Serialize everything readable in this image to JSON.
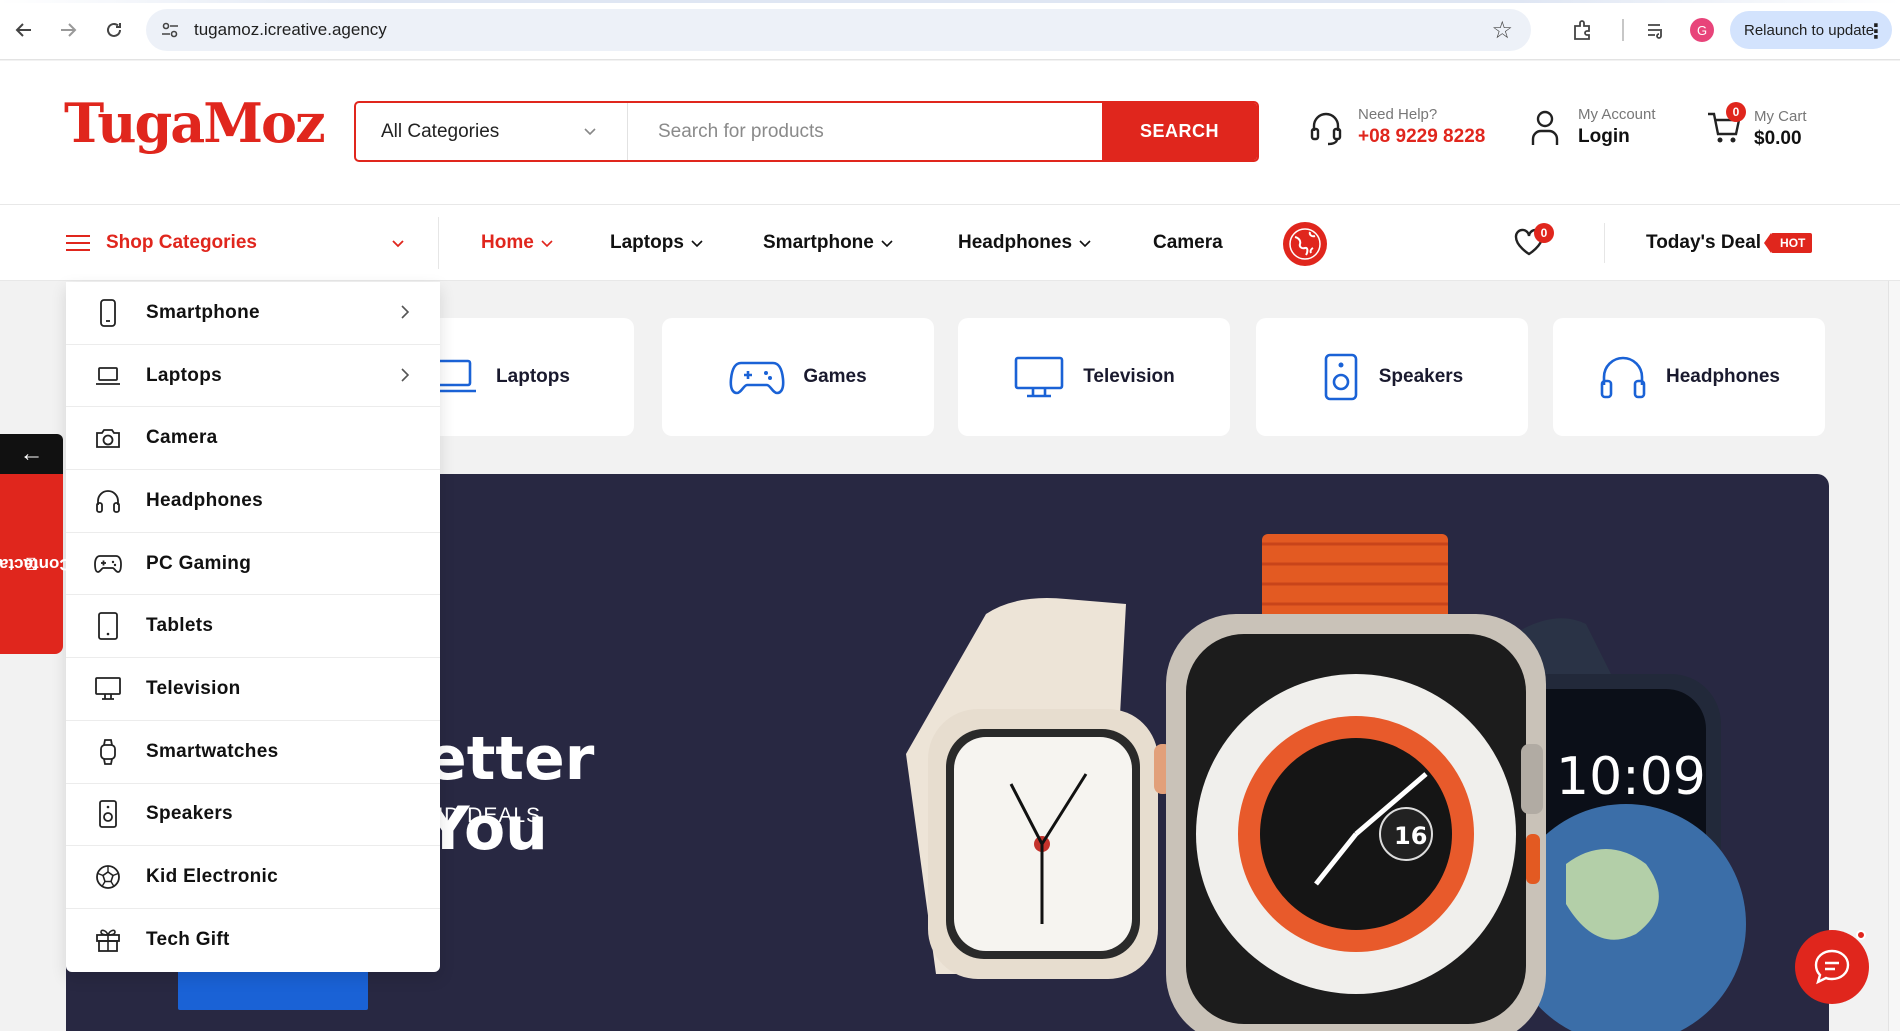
{
  "browser": {
    "url": "tugamoz.icreative.agency",
    "profile_initial": "G",
    "relaunch_label": "Relaunch to update"
  },
  "header": {
    "logo_part1": "Tuga",
    "logo_part2": "Moz",
    "category_select": "All Categories",
    "search_placeholder": "Search for products",
    "search_button": "SEARCH",
    "help_label": "Need Help?",
    "help_phone": "+08 9229 8228",
    "account_label": "My Account",
    "account_action": "Login",
    "cart_label": "My Cart",
    "cart_total": "$0.00",
    "cart_count": "0"
  },
  "nav": {
    "shop_categories": "Shop Categories",
    "items": [
      {
        "label": "Home",
        "has_dropdown": true,
        "active": true
      },
      {
        "label": "Laptops",
        "has_dropdown": true
      },
      {
        "label": "Smartphone",
        "has_dropdown": true
      },
      {
        "label": "Headphones",
        "has_dropdown": true
      },
      {
        "label": "Camera",
        "has_dropdown": false
      }
    ],
    "wishlist_count": "0",
    "todays_deal": "Today's Deal",
    "hot_badge": "HOT"
  },
  "dropdown": {
    "items": [
      {
        "label": "Smartphone",
        "icon": "smartphone-icon",
        "has_submenu": true
      },
      {
        "label": "Laptops",
        "icon": "laptop-icon",
        "has_submenu": true
      },
      {
        "label": "Camera",
        "icon": "camera-icon",
        "has_submenu": false
      },
      {
        "label": "Headphones",
        "icon": "headphones-icon",
        "has_submenu": false
      },
      {
        "label": "PC Gaming",
        "icon": "gamepad-icon",
        "has_submenu": false
      },
      {
        "label": "Tablets",
        "icon": "tablet-icon",
        "has_submenu": false
      },
      {
        "label": "Television",
        "icon": "television-icon",
        "has_submenu": false
      },
      {
        "label": "Smartwatches",
        "icon": "smartwatch-icon",
        "has_submenu": false
      },
      {
        "label": "Speakers",
        "icon": "speaker-icon",
        "has_submenu": false
      },
      {
        "label": "Kid Electronic",
        "icon": "ball-icon",
        "has_submenu": false
      },
      {
        "label": "Tech Gift",
        "icon": "gift-icon",
        "has_submenu": false
      }
    ]
  },
  "category_cards": [
    {
      "label": "Laptops",
      "icon": "laptop-icon"
    },
    {
      "label": "Games",
      "icon": "gamepad-icon"
    },
    {
      "label": "Television",
      "icon": "television-icon"
    },
    {
      "label": "Speakers",
      "icon": "speaker-icon"
    },
    {
      "label": "Headphones",
      "icon": "headphones-icon"
    }
  ],
  "hero": {
    "title_visible": "etter You",
    "subtitle_visible": "ND DEALS",
    "watch_time": "10:09",
    "watch_date": "16"
  },
  "floating": {
    "back_arrow": "←",
    "contact_label": "Contactar"
  },
  "colors": {
    "accent": "#e0261d",
    "hero_bg": "#282842",
    "icon_blue": "#1a62d6"
  }
}
